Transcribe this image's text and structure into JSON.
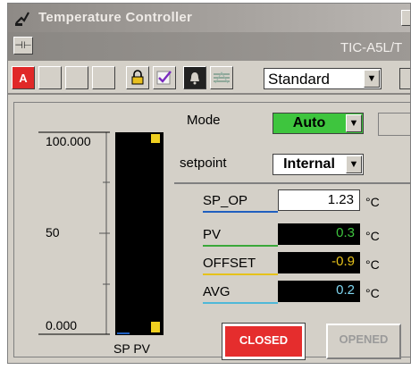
{
  "window": {
    "title": "Temperature Controller",
    "tag": "TIC-A5L/T"
  },
  "toolbar": {
    "alarm_label": "A",
    "view_select": "Standard"
  },
  "bar_scale": {
    "max_label": "100.000",
    "mid_label": "50",
    "min_label": "0.000",
    "bar_labels": "SP PV",
    "pv_level": 1.0
  },
  "controls": {
    "mode_label": "Mode",
    "mode_value": "Auto",
    "setpoint_label": "setpoint",
    "setpoint_value": "Internal"
  },
  "values": [
    {
      "label": "SP_OP",
      "value": "1.23",
      "unit": "°C",
      "color": "#1f5fbf",
      "value_color": "#000000"
    },
    {
      "label": "PV",
      "value": "0.3",
      "unit": "°C",
      "color": "#3aa83a",
      "value_color": "#3ec53e"
    },
    {
      "label": "OFFSET",
      "value": "-0.9",
      "unit": "°C",
      "color": "#e6c21a",
      "value_color": "#e6c21a"
    },
    {
      "label": "AVG",
      "value": "0.2",
      "unit": "°C",
      "color": "#4fb8d8",
      "value_color": "#7fd6f0"
    }
  ],
  "buttons": {
    "closed_label": "CLOSED",
    "opened_label": "OPENED"
  }
}
